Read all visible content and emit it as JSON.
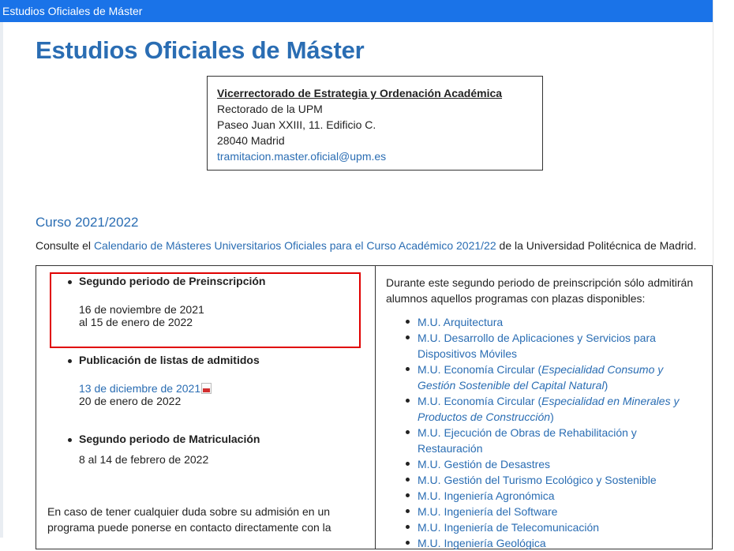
{
  "topbar": {
    "title": "Estudios Oficiales de Máster"
  },
  "page": {
    "title": "Estudios Oficiales de Máster"
  },
  "address": {
    "office": "Vicerrectorado de Estrategia y Ordenación Académica",
    "line1": "Rectorado de la UPM",
    "line2": "Paseo Juan XXIII, 11. Edificio C.",
    "line3": "28040 Madrid",
    "email": "tramitacion.master.oficial@upm.es"
  },
  "course": {
    "heading": "Curso 2021/2022",
    "intro_prefix": "Consulte el ",
    "intro_link": "Calendario de Másteres Universitarios Oficiales para el Curso Académico 2021/22",
    "intro_suffix": " de la Universidad Politécnica de Madrid."
  },
  "left": {
    "preinscription": {
      "title": "Segundo periodo de Preinscripción",
      "line1": "16 de noviembre de 2021",
      "line2": "al 15 de enero de 2022"
    },
    "publication": {
      "title": "Publicación de listas de admitidos",
      "link": "13 de diciembre de 2021",
      "line2": "20 de enero de 2022"
    },
    "enrollment": {
      "title": "Segundo periodo de Matriculación",
      "line1": "8 al 14 de febrero de 2022"
    },
    "contact_line1": "En caso de tener cualquier duda sobre su admisión en un",
    "contact_line2": "programa puede ponerse en contacto directamente con la"
  },
  "right": {
    "note_line1": "Durante este segundo periodo de preinscripción sólo admitirán",
    "note_line2": "alumnos aquellos programas con plazas disponibles:",
    "programs": {
      "p1": "M.U. Arquitectura",
      "p2": "M.U. Desarrollo de Aplicaciones y Servicios para Dispositivos Móviles",
      "p3_main": "M.U. Economía Circular (",
      "p3_spec": "Especialidad Consumo y Gestión Sostenible del Capital Natural",
      "p3_end": ")",
      "p4_main": "M.U. Economía Circular (",
      "p4_spec": "Especialidad en Minerales y Productos de Construcción",
      "p4_end": ")",
      "p5": "M.U. Ejecución de Obras de Rehabilitación y Restauración",
      "p6": "M.U. Gestión de Desastres",
      "p7": "M.U. Gestión del Turismo Ecológico y Sostenible",
      "p8": "M.U. Ingeniería Agronómica",
      "p9": "M.U. Ingeniería del Software",
      "p10": "M.U. Ingeniería de Telecomunicación",
      "p11": "M.U. Ingeniería Geológica"
    }
  },
  "colors": {
    "topbar": "#1a73e8",
    "link": "#2a6db3",
    "highlight": "#e00000"
  }
}
